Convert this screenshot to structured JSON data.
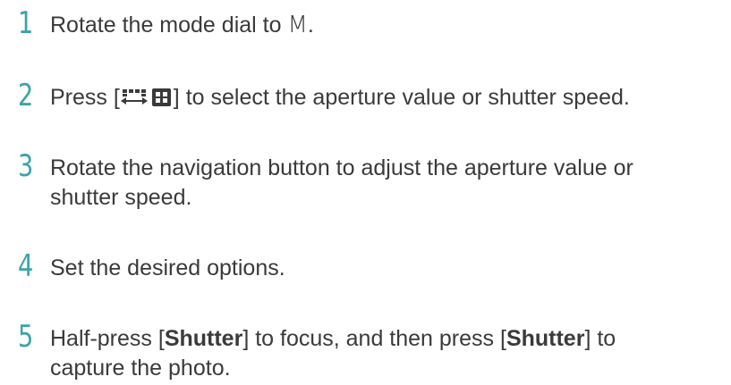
{
  "steps": [
    {
      "number": "1",
      "text_before": "Rotate the mode dial to ",
      "mode": "M",
      "text_after": "."
    },
    {
      "number": "2",
      "text_before": "Press [",
      "icon": "aperture-shutter-key-icon",
      "text_after": "] to select the aperture value or shutter speed."
    },
    {
      "number": "3",
      "line1": "Rotate the navigation button to adjust the aperture value or",
      "line2": "shutter speed."
    },
    {
      "number": "4",
      "text": "Set the desired options."
    },
    {
      "number": "5",
      "part1": "Half-press [",
      "shutter1": "Shutter",
      "part2": "] to focus, and then press [",
      "shutter2": "Shutter",
      "part3": "] to",
      "line2": "capture the photo."
    }
  ],
  "colors": {
    "accent": "#3aa3a8",
    "text": "#3a3a3a"
  }
}
